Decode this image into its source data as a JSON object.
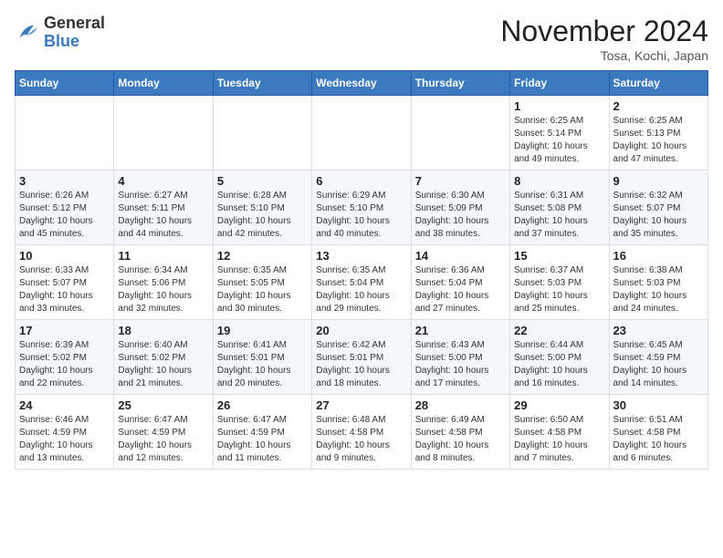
{
  "header": {
    "logo_general": "General",
    "logo_blue": "Blue",
    "month_title": "November 2024",
    "location": "Tosa, Kochi, Japan"
  },
  "weekdays": [
    "Sunday",
    "Monday",
    "Tuesday",
    "Wednesday",
    "Thursday",
    "Friday",
    "Saturday"
  ],
  "weeks": [
    [
      {
        "day": "",
        "info": ""
      },
      {
        "day": "",
        "info": ""
      },
      {
        "day": "",
        "info": ""
      },
      {
        "day": "",
        "info": ""
      },
      {
        "day": "",
        "info": ""
      },
      {
        "day": "1",
        "info": "Sunrise: 6:25 AM\nSunset: 5:14 PM\nDaylight: 10 hours\nand 49 minutes."
      },
      {
        "day": "2",
        "info": "Sunrise: 6:25 AM\nSunset: 5:13 PM\nDaylight: 10 hours\nand 47 minutes."
      }
    ],
    [
      {
        "day": "3",
        "info": "Sunrise: 6:26 AM\nSunset: 5:12 PM\nDaylight: 10 hours\nand 45 minutes."
      },
      {
        "day": "4",
        "info": "Sunrise: 6:27 AM\nSunset: 5:11 PM\nDaylight: 10 hours\nand 44 minutes."
      },
      {
        "day": "5",
        "info": "Sunrise: 6:28 AM\nSunset: 5:10 PM\nDaylight: 10 hours\nand 42 minutes."
      },
      {
        "day": "6",
        "info": "Sunrise: 6:29 AM\nSunset: 5:10 PM\nDaylight: 10 hours\nand 40 minutes."
      },
      {
        "day": "7",
        "info": "Sunrise: 6:30 AM\nSunset: 5:09 PM\nDaylight: 10 hours\nand 38 minutes."
      },
      {
        "day": "8",
        "info": "Sunrise: 6:31 AM\nSunset: 5:08 PM\nDaylight: 10 hours\nand 37 minutes."
      },
      {
        "day": "9",
        "info": "Sunrise: 6:32 AM\nSunset: 5:07 PM\nDaylight: 10 hours\nand 35 minutes."
      }
    ],
    [
      {
        "day": "10",
        "info": "Sunrise: 6:33 AM\nSunset: 5:07 PM\nDaylight: 10 hours\nand 33 minutes."
      },
      {
        "day": "11",
        "info": "Sunrise: 6:34 AM\nSunset: 5:06 PM\nDaylight: 10 hours\nand 32 minutes."
      },
      {
        "day": "12",
        "info": "Sunrise: 6:35 AM\nSunset: 5:05 PM\nDaylight: 10 hours\nand 30 minutes."
      },
      {
        "day": "13",
        "info": "Sunrise: 6:35 AM\nSunset: 5:04 PM\nDaylight: 10 hours\nand 29 minutes."
      },
      {
        "day": "14",
        "info": "Sunrise: 6:36 AM\nSunset: 5:04 PM\nDaylight: 10 hours\nand 27 minutes."
      },
      {
        "day": "15",
        "info": "Sunrise: 6:37 AM\nSunset: 5:03 PM\nDaylight: 10 hours\nand 25 minutes."
      },
      {
        "day": "16",
        "info": "Sunrise: 6:38 AM\nSunset: 5:03 PM\nDaylight: 10 hours\nand 24 minutes."
      }
    ],
    [
      {
        "day": "17",
        "info": "Sunrise: 6:39 AM\nSunset: 5:02 PM\nDaylight: 10 hours\nand 22 minutes."
      },
      {
        "day": "18",
        "info": "Sunrise: 6:40 AM\nSunset: 5:02 PM\nDaylight: 10 hours\nand 21 minutes."
      },
      {
        "day": "19",
        "info": "Sunrise: 6:41 AM\nSunset: 5:01 PM\nDaylight: 10 hours\nand 20 minutes."
      },
      {
        "day": "20",
        "info": "Sunrise: 6:42 AM\nSunset: 5:01 PM\nDaylight: 10 hours\nand 18 minutes."
      },
      {
        "day": "21",
        "info": "Sunrise: 6:43 AM\nSunset: 5:00 PM\nDaylight: 10 hours\nand 17 minutes."
      },
      {
        "day": "22",
        "info": "Sunrise: 6:44 AM\nSunset: 5:00 PM\nDaylight: 10 hours\nand 16 minutes."
      },
      {
        "day": "23",
        "info": "Sunrise: 6:45 AM\nSunset: 4:59 PM\nDaylight: 10 hours\nand 14 minutes."
      }
    ],
    [
      {
        "day": "24",
        "info": "Sunrise: 6:46 AM\nSunset: 4:59 PM\nDaylight: 10 hours\nand 13 minutes."
      },
      {
        "day": "25",
        "info": "Sunrise: 6:47 AM\nSunset: 4:59 PM\nDaylight: 10 hours\nand 12 minutes."
      },
      {
        "day": "26",
        "info": "Sunrise: 6:47 AM\nSunset: 4:59 PM\nDaylight: 10 hours\nand 11 minutes."
      },
      {
        "day": "27",
        "info": "Sunrise: 6:48 AM\nSunset: 4:58 PM\nDaylight: 10 hours\nand 9 minutes."
      },
      {
        "day": "28",
        "info": "Sunrise: 6:49 AM\nSunset: 4:58 PM\nDaylight: 10 hours\nand 8 minutes."
      },
      {
        "day": "29",
        "info": "Sunrise: 6:50 AM\nSunset: 4:58 PM\nDaylight: 10 hours\nand 7 minutes."
      },
      {
        "day": "30",
        "info": "Sunrise: 6:51 AM\nSunset: 4:58 PM\nDaylight: 10 hours\nand 6 minutes."
      }
    ]
  ]
}
